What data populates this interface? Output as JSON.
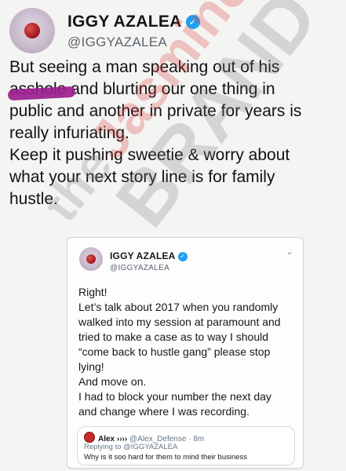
{
  "tweet": {
    "display_name": "IGGY AZALEA",
    "verified_mark": "✓",
    "handle": "@IGGYAZALEA",
    "lines": [
      "But seeing a man speaking out of his",
      "asshole and blurting our one thing in",
      "public and another in private for years is",
      "really infuriating.",
      "Keep it pushing sweetie & worry about",
      "what your next story line is for family",
      "hustle."
    ]
  },
  "quoted_tweet": {
    "display_name": "IGGY AZALEA",
    "verified_mark": "✓",
    "handle": "@IGGYAZALEA",
    "menu_glyph": "⌄",
    "lines": [
      "Right!",
      "Let’s talk about 2017 when you randomly",
      "walked into my session at paramount and",
      "tried to make a case as to way I should",
      "“come back to hustle gang” please stop",
      "lying!",
      "And move on.",
      "I had to block your number the next day",
      "and change where I was recording."
    ],
    "reply": {
      "name": "Alex ››››",
      "handle": "@Alex_Defense",
      "time": "· 8m",
      "replying_to": "Replying to @IGGYAZALEA",
      "text": "Why is it soo hard for them to mind their business"
    }
  },
  "watermark": {
    "word1": "the",
    "word2": "Jasmine",
    "word3": "BRAND"
  },
  "colors": {
    "background": "#f4f4f2",
    "verified": "#1da1f2",
    "scribble": "#9a1e8f"
  },
  "icons": [
    "profile-avatar",
    "verified-badge-icon",
    "chevron-down-icon",
    "reply-avatar-icon"
  ]
}
